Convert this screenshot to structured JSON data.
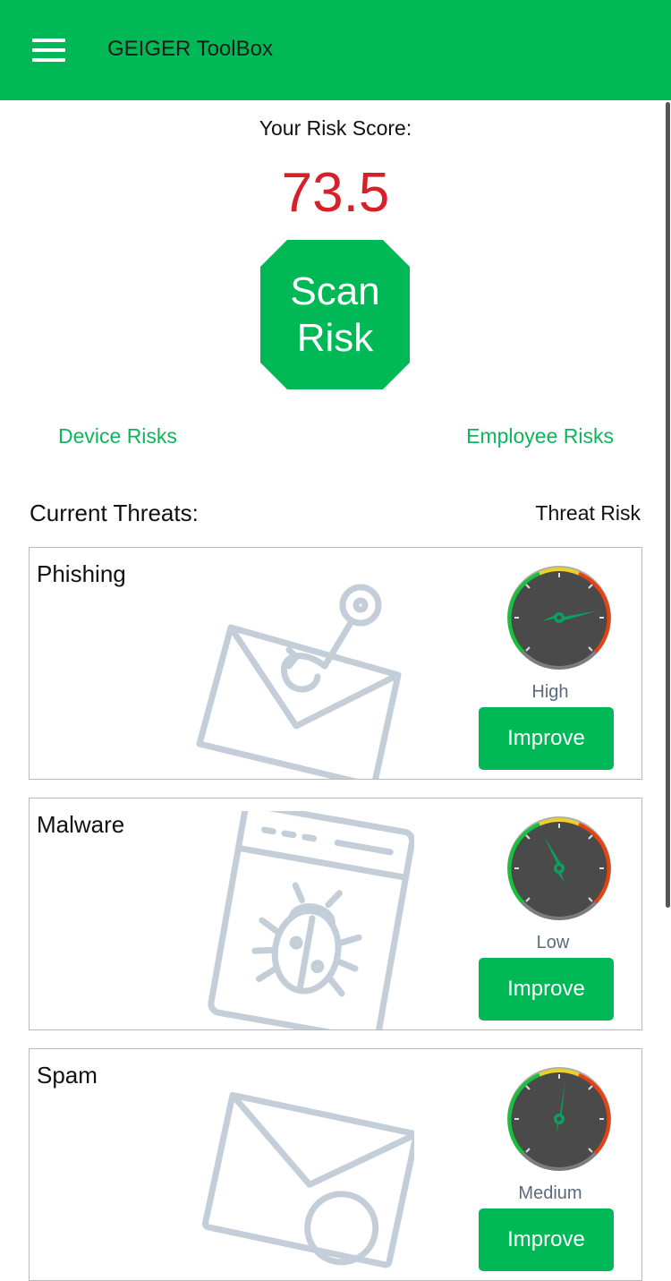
{
  "app": {
    "title": "GEIGER ToolBox"
  },
  "score": {
    "label": "Your Risk Score:",
    "value": "73.5"
  },
  "scan": {
    "label": "Scan\nRisk"
  },
  "links": {
    "device": "Device Risks",
    "employee": "Employee Risks"
  },
  "threats": {
    "title": "Current Threats:",
    "column_label": "Threat Risk",
    "items": [
      {
        "name": "Phishing",
        "level": "High",
        "button": "Improve"
      },
      {
        "name": "Malware",
        "level": "Low",
        "button": "Improve"
      },
      {
        "name": "Spam",
        "level": "Medium",
        "button": "Improve"
      }
    ]
  },
  "colors": {
    "brand_green": "#00b956",
    "score_red": "#d8202a",
    "illustration": "#c4ced8"
  }
}
